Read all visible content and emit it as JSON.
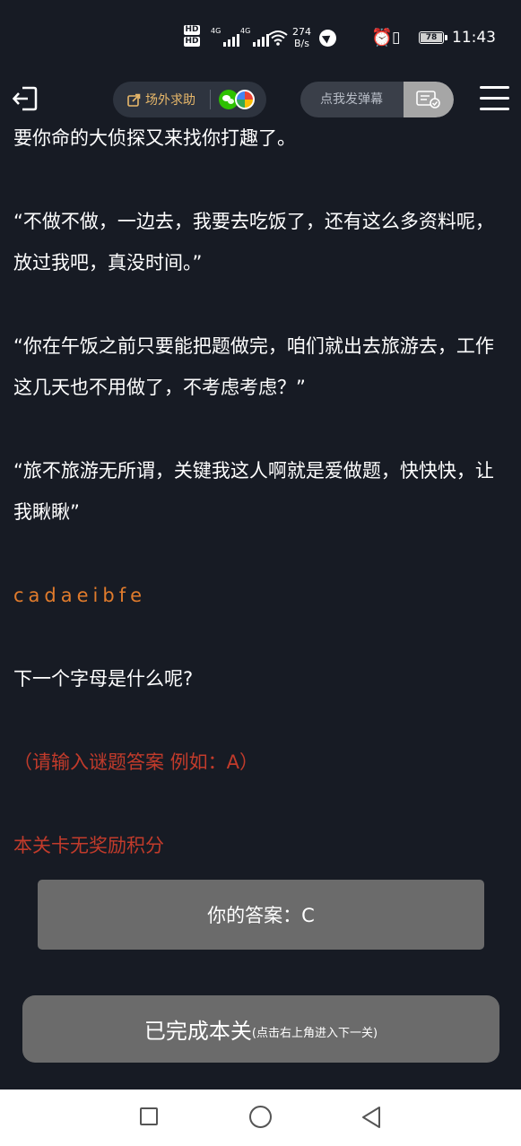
{
  "status_bar": {
    "hd_top": "HD",
    "hd_bottom": "HD",
    "net1": "4G",
    "net2": "4G",
    "speed_value": "274",
    "speed_unit": "B/s",
    "battery": "78",
    "time": "11:43",
    "icons": [
      "signal-icon",
      "wifi-icon",
      "navigation-icon",
      "alarm-icon",
      "vibrate-icon",
      "battery-icon"
    ]
  },
  "toolbar": {
    "exit_icon": "exit-icon",
    "help_label": "场外求助",
    "help_icon": "share-edit-icon",
    "wechat_icon": "wechat-icon",
    "pinwheel_icon": "pinwheel-icon",
    "danmaku_placeholder": "点我发弹幕",
    "danmaku_send_icon": "danmaku-send-icon",
    "menu_icon": "hamburger-menu-icon"
  },
  "story": {
    "p1": "要你命的大侦探又来找你打趣了。",
    "p2": "“不做不做，一边去，我要去吃饭了，还有这么多资料呢，放过我吧，真没时间。”",
    "p3": "“你在午饭之前只要能把题做完，咱们就出去旅游去，工作这几天也不用做了，不考虑考虑？”",
    "p4": "“旅不旅游无所谓，关键我这人啊就是爱做题，快快快，让我瞅瞅”",
    "code": "cadaeibfe",
    "question": "下一个字母是什么呢?",
    "hint": "（请输入谜题答案 例如：A）",
    "reward": "本关卡无奖励积分"
  },
  "answer": {
    "label": "你的答案：C"
  },
  "done_button": {
    "main": "已完成本关",
    "sub": "(点击右上角进入下一关)"
  },
  "colors": {
    "background": "#171b24",
    "accent_orange": "#e07b2c",
    "hint_red": "#c23b2b",
    "gold": "#e8b86a",
    "button_gray": "#6b6b6b"
  }
}
